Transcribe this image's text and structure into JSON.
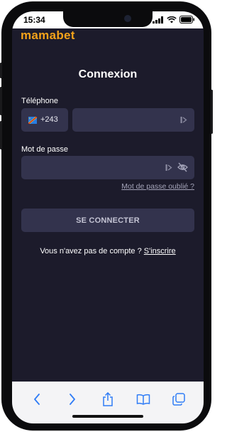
{
  "status_bar": {
    "time": "15:34"
  },
  "app": {
    "logo": "mamabet"
  },
  "login": {
    "title": "Connexion",
    "phone_label": "Téléphone",
    "country_code": "+243",
    "phone_value": "",
    "password_label": "Mot de passe",
    "password_value": "",
    "forgot_link": "Mot de passe oublié ?",
    "submit_label": "SE CONNECTER",
    "no_account_text": "Vous n'avez pas de compte ?",
    "signup_link": "S'inscrire"
  },
  "colors": {
    "background": "#1c1b2b",
    "field": "#33334d",
    "brand": "#f5a31a",
    "toolbar": "#f4f4f6",
    "toolbar_icon": "#2f7cf6"
  },
  "icons": {
    "status": [
      "signal-icon",
      "wifi-icon",
      "battery-icon"
    ],
    "field": [
      "paste-icon",
      "eye-off-icon"
    ],
    "toolbar": [
      "back-icon",
      "forward-icon",
      "share-icon",
      "bookmarks-icon",
      "tabs-icon"
    ]
  }
}
